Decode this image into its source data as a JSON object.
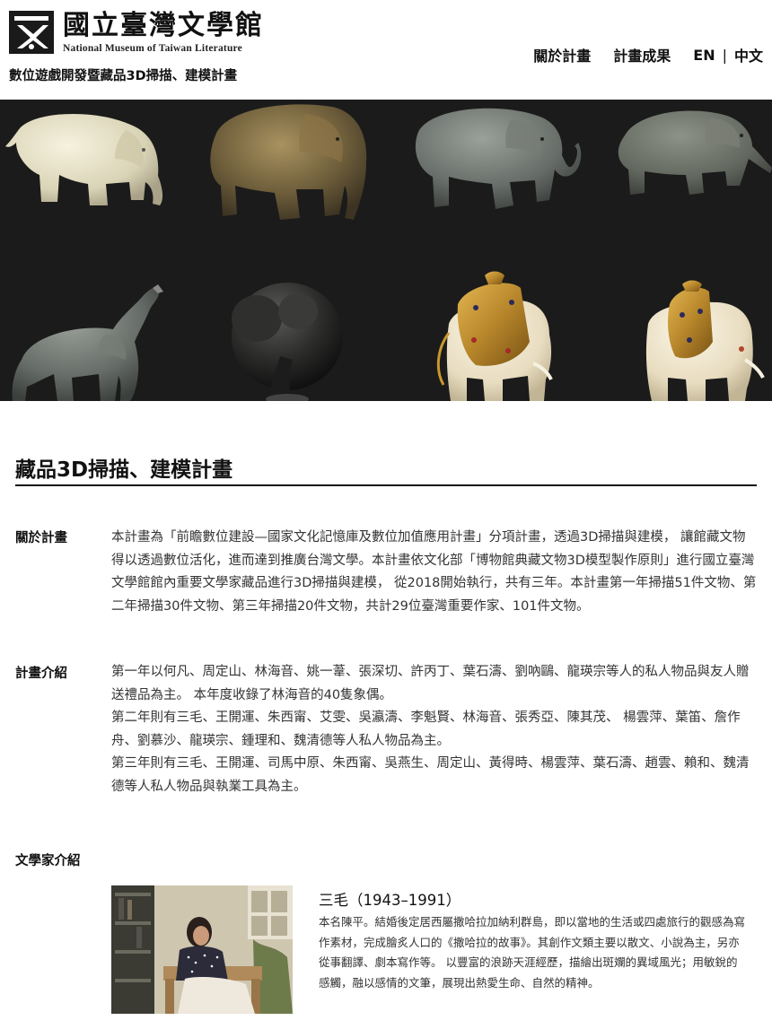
{
  "header": {
    "logo_cn": "國立臺灣文學館",
    "logo_en": "National Museum of Taiwan Literature",
    "subtitle": "數位遊戲開發暨藏品3D掃描、建模計畫"
  },
  "nav": {
    "about": "關於計畫",
    "results": "計畫成果",
    "lang_en": "EN",
    "lang_sep": "|",
    "lang_zh": "中文"
  },
  "hero": {
    "background": "#1b1b1b",
    "icons": [
      "white-elephant-figurine",
      "bronze-elephant-figurine",
      "grey-elephant-figurine",
      "grey-elephant-figurine",
      "trumpeting-elephant-figurine",
      "black-elephant-figurine",
      "ornate-elephant-pendant",
      "ornate-elephant-pendant"
    ]
  },
  "main": {
    "title": "藏品3D掃描、建模計畫",
    "about": {
      "label": "關於計畫",
      "text": "本計畫為「前瞻數位建設—國家文化記憶庫及數位加值應用計畫」分項計畫，透過3D掃描與建模， 讓館藏文物得以透過數位活化，進而達到推廣台灣文學。本計畫依文化部「博物館典藏文物3D模型製作原則」進行國立臺灣文學館館內重要文學家藏品進行3D掃描與建模， 從2018開始執行，共有三年。本計畫第一年掃描51件文物、第二年掃描30件文物、第三年掃描20件文物，共計29位臺灣重要作家、101件文物。"
    },
    "intro": {
      "label": "計畫介紹",
      "year1": "第一年以何凡、周定山、林海音、姚一葦、張深切、許丙丁、葉石濤、劉吶鷗、龍瑛宗等人的私人物品與友人贈送禮品為主。 本年度收錄了林海音的40隻象偶。",
      "year2": "第二年則有三毛、王開運、朱西甯、艾雯、吳瀛濤、李魁賢、林海音、張秀亞、陳其茂、 楊雲萍、葉笛、詹作舟、劉慕沙、龍瑛宗、鍾理和、魏清德等人私人物品為主。",
      "year3": "第三年則有三毛、王開運、司馬中原、朱西甯、吳燕生、周定山、黃得時、楊雲萍、葉石濤、趙雲、賴和、魏清德等人私人物品與執業工具為主。"
    },
    "writers": {
      "label": "文學家介紹",
      "items": [
        {
          "name": "三毛（1943–1991）",
          "bio": "本名陳平。結婚後定居西屬撒哈拉加納利群島，即以當地的生活或四處旅行的觀感為寫作素材，完成膾炙人口的《撒哈拉的故事》。其創作文類主要以散文、小說為主，另亦從事翻譯、劇本寫作等。 以豐富的浪跡天涯經歷，描繪出斑斕的異域風光；用敏銳的感觸，融以感情的文筆，展現出熱愛生命、自然的精神。"
        }
      ]
    }
  }
}
